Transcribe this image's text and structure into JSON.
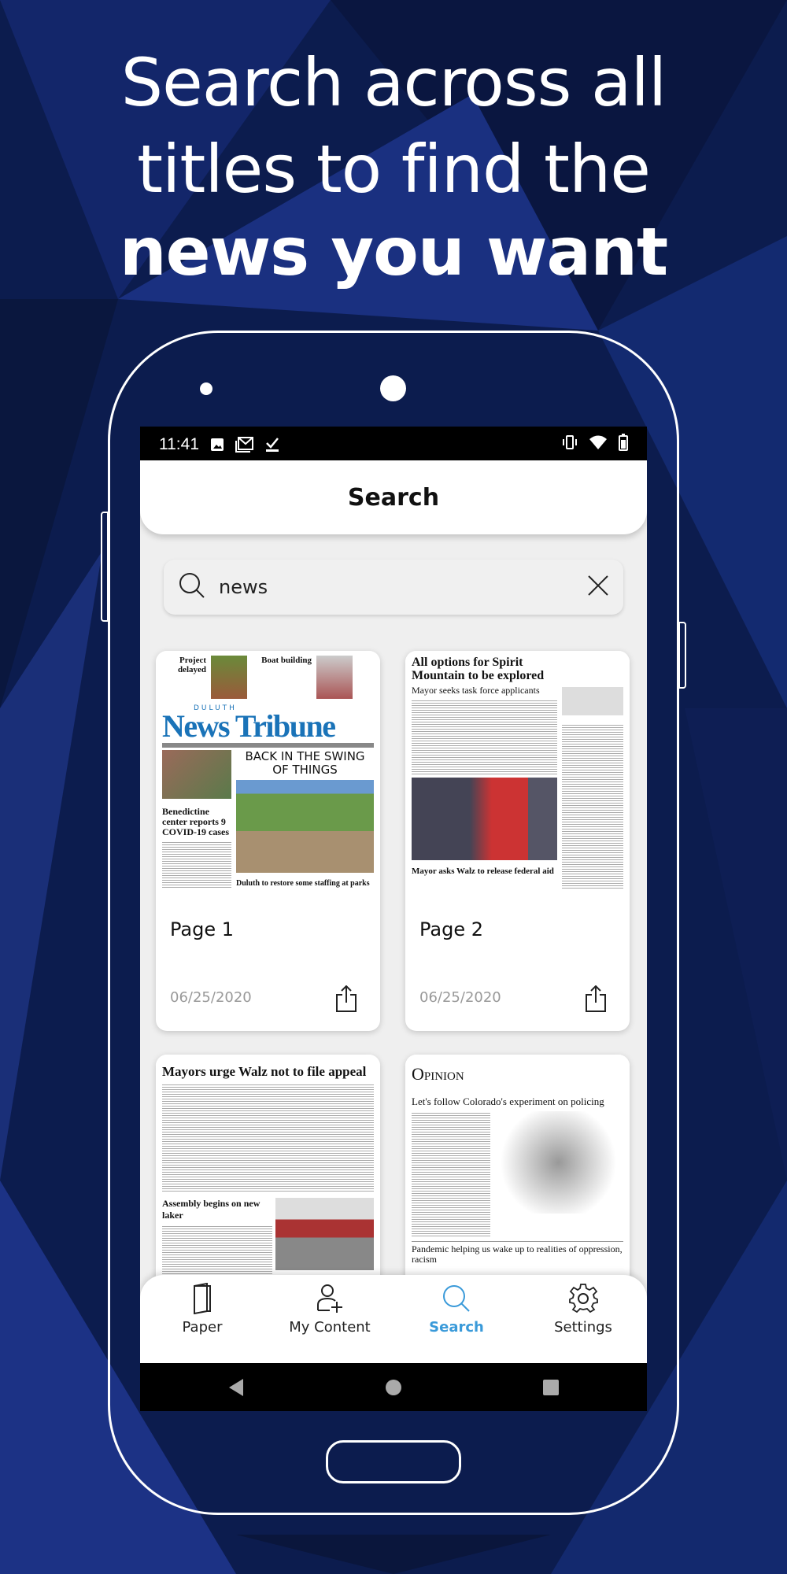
{
  "promo": {
    "line1": "Search across all",
    "line2": "titles to find the",
    "line3": "news you want"
  },
  "status_bar": {
    "time": "11:41",
    "icons": [
      "image-icon",
      "gmail-icon",
      "task-check-icon"
    ],
    "right_icons": [
      "vibrate-icon",
      "wifi-icon",
      "battery-icon"
    ]
  },
  "header": {
    "title": "Search"
  },
  "search": {
    "value": "news",
    "placeholder": ""
  },
  "results": [
    {
      "page": "Page 1",
      "date": "06/25/2020",
      "thumb": {
        "masthead_small": "DULUTH",
        "masthead": "News Tribune",
        "teaser1": "Project delayed",
        "teaser2": "Boat building",
        "h1": "BACK IN THE SWING OF THINGS",
        "h2": "Benedictine center reports 9 COVID-19 cases",
        "h3": "Duluth to restore some staffing at parks"
      }
    },
    {
      "page": "Page 2",
      "date": "06/25/2020",
      "thumb": {
        "h1": "All options for Spirit Mountain to be explored",
        "h2": "Mayor seeks task force applicants",
        "h3": "Mayor asks Walz to release federal aid"
      }
    },
    {
      "page": "",
      "date": "",
      "thumb": {
        "h1": "Mayors urge Walz not to file appeal",
        "h2": "Assembly begins on new laker"
      }
    },
    {
      "page": "",
      "date": "",
      "thumb": {
        "h1": "Opinion",
        "h2": "Let's follow Colorado's experiment on policing",
        "h3": "Pandemic helping us wake up to realities of oppression, racism"
      }
    }
  ],
  "bottom_nav": [
    {
      "label": "Paper",
      "icon": "paper-icon",
      "active": false
    },
    {
      "label": "My Content",
      "icon": "add-user-icon",
      "active": false
    },
    {
      "label": "Search",
      "icon": "search-icon",
      "active": true
    },
    {
      "label": "Settings",
      "icon": "gear-icon",
      "active": false
    }
  ],
  "colors": {
    "accent": "#3a9ad9",
    "background": "#0b1a4a",
    "masthead": "#1a73b8"
  }
}
